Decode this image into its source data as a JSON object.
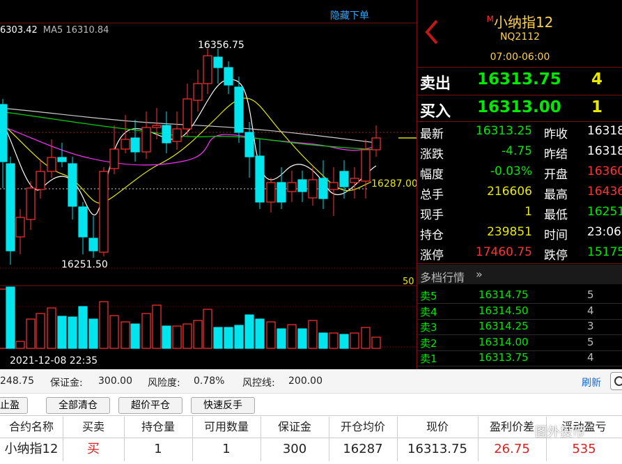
{
  "chart": {
    "hide_order_label": "隐藏下单",
    "ma_line": {
      "prefix": "6303.42",
      "label": "MA5 16310.84"
    },
    "high_label": "16356.75",
    "low_label": "16251.50",
    "last_tag": "16287.00",
    "vol_axis_label": "50",
    "date_label": "2021-12-08 22:35",
    "colors": {
      "up": "#ff3232",
      "down": "#00e5ee",
      "ma5": "#ffffff",
      "ma10": "#e8e800",
      "ma20": "#ff30ff",
      "ma60": "#00d000",
      "price_line": "#dcdc00"
    }
  },
  "quote": {
    "badge": "M",
    "name": "小纳指12",
    "code": "NQ2112",
    "session": "07:00-06:00",
    "sell_label": "卖出",
    "sell_price": "16313.75",
    "sell_qty": "4",
    "buy_label": "买入",
    "buy_price": "16313.00",
    "buy_qty": "1",
    "rows": [
      {
        "l1": "最新",
        "v1": "16313.25",
        "c1": "#00e800",
        "l2": "昨收",
        "v2": "16318",
        "c2": "#ffffff"
      },
      {
        "l1": "涨跌",
        "v1": "-4.75",
        "c1": "#00e800",
        "l2": "昨结",
        "v2": "16318",
        "c2": "#ffffff"
      },
      {
        "l1": "幅度",
        "v1": "-0.03%",
        "c1": "#00e800",
        "l2": "开盘",
        "v2": "16360",
        "c2": "#ff3232"
      },
      {
        "l1": "总手",
        "v1": "216606",
        "c1": "#e8e800",
        "l2": "最高",
        "v2": "16436",
        "c2": "#ff3232"
      },
      {
        "l1": "现手",
        "v1": "1",
        "c1": "#e8e800",
        "l2": "最低",
        "v2": "16251",
        "c2": "#00e800"
      },
      {
        "l1": "持仓",
        "v1": "239851",
        "c1": "#e8e800",
        "l2": "时间",
        "v2": "23:06",
        "c2": "#ffffff"
      },
      {
        "l1": "涨停",
        "v1": "17460.75",
        "c1": "#ff3232",
        "l2": "跌停",
        "v2": "15175",
        "c2": "#00e800"
      }
    ],
    "depth_title": "多档行情",
    "depth": [
      {
        "label": "卖5",
        "price": "16314.75",
        "qty": "5"
      },
      {
        "label": "卖4",
        "price": "16314.50",
        "qty": "4"
      },
      {
        "label": "卖3",
        "price": "16314.25",
        "qty": "3"
      },
      {
        "label": "卖2",
        "price": "16314.00",
        "qty": "5"
      },
      {
        "label": "卖1",
        "price": "16313.75",
        "qty": "4"
      }
    ]
  },
  "account": {
    "balance": "248.75",
    "margin_label": "保证金:",
    "margin": "300.00",
    "risk_label": "风险度:",
    "risk": "0.78%",
    "control_label": "风控线:",
    "control": "200.00",
    "refresh": "刷新"
  },
  "buttons": [
    "止盈",
    "全部清仓",
    "超价平仓",
    "快速反手"
  ],
  "table": {
    "headers": [
      "合约名称",
      "买卖",
      "持仓量",
      "可用数量",
      "保证金",
      "开仓均价",
      "现价",
      "盈利价差",
      "浮动盈亏"
    ],
    "row": [
      "小纳指12",
      "买",
      "1",
      "1",
      "300",
      "16287",
      "16313.75",
      "26.75",
      "535"
    ]
  },
  "watermark": "图外投币"
}
